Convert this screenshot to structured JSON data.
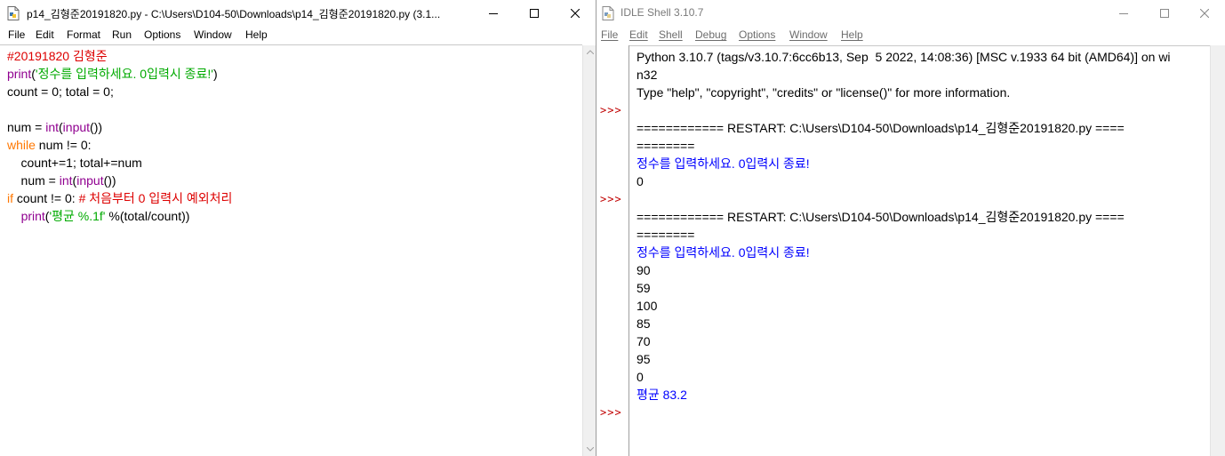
{
  "editor": {
    "title": "p14_김형준20191820.py - C:\\Users\\D104-50\\Downloads\\p14_김형준20191820.py (3.1...",
    "menu": [
      "File",
      "Edit",
      "Format",
      "Run",
      "Options",
      "Window",
      "Help"
    ],
    "code_lines": [
      [
        {
          "t": "#20191820 김형준",
          "c": "comment"
        }
      ],
      [
        {
          "t": "print",
          "c": "builtin"
        },
        {
          "t": "(",
          "c": ""
        },
        {
          "t": "'정수를 입력하세요. 0입력시 종료!'",
          "c": "string"
        },
        {
          "t": ")",
          "c": ""
        }
      ],
      [
        {
          "t": "count = 0; total = 0;",
          "c": ""
        }
      ],
      [
        {
          "t": "",
          "c": ""
        }
      ],
      [
        {
          "t": "num = ",
          "c": ""
        },
        {
          "t": "int",
          "c": "builtin"
        },
        {
          "t": "(",
          "c": ""
        },
        {
          "t": "input",
          "c": "builtin"
        },
        {
          "t": "())",
          "c": ""
        }
      ],
      [
        {
          "t": "while",
          "c": "keyword"
        },
        {
          "t": " num != 0:",
          "c": ""
        }
      ],
      [
        {
          "t": "    count+=1; total+=num",
          "c": ""
        }
      ],
      [
        {
          "t": "    num = ",
          "c": ""
        },
        {
          "t": "int",
          "c": "builtin"
        },
        {
          "t": "(",
          "c": ""
        },
        {
          "t": "input",
          "c": "builtin"
        },
        {
          "t": "())",
          "c": ""
        }
      ],
      [
        {
          "t": "if",
          "c": "keyword"
        },
        {
          "t": " count != 0: ",
          "c": ""
        },
        {
          "t": "# 처음부터 0 입력시 예외처리",
          "c": "comment"
        }
      ],
      [
        {
          "t": "    ",
          "c": ""
        },
        {
          "t": "print",
          "c": "builtin"
        },
        {
          "t": "(",
          "c": ""
        },
        {
          "t": "'평균 %.1f'",
          "c": "string"
        },
        {
          "t": " %(total/count))",
          "c": ""
        }
      ]
    ]
  },
  "shell": {
    "title": "IDLE Shell 3.10.7",
    "menu": [
      "File",
      "Edit",
      "Shell",
      "Debug",
      "Options",
      "Window",
      "Help"
    ],
    "prompt_symbol": ">>>",
    "prompt_rows": [
      3,
      8,
      20
    ],
    "lines": [
      {
        "t": "Python 3.10.7 (tags/v3.10.7:6cc6b13, Sep  5 2022, 14:08:36) [MSC v.1933 64 bit (AMD64)] on wi",
        "c": ""
      },
      {
        "t": "n32",
        "c": ""
      },
      {
        "t": "Type \"help\", \"copyright\", \"credits\" or \"license()\" for more information.",
        "c": ""
      },
      {
        "t": "",
        "c": ""
      },
      {
        "t": "============ RESTART: C:\\Users\\D104-50\\Downloads\\p14_김형준20191820.py ====",
        "c": ""
      },
      {
        "t": "========",
        "c": ""
      },
      {
        "t": "정수를 입력하세요. 0입력시 종료!",
        "c": "stdout"
      },
      {
        "t": "0",
        "c": ""
      },
      {
        "t": "",
        "c": ""
      },
      {
        "t": "============ RESTART: C:\\Users\\D104-50\\Downloads\\p14_김형준20191820.py ====",
        "c": ""
      },
      {
        "t": "========",
        "c": ""
      },
      {
        "t": "정수를 입력하세요. 0입력시 종료!",
        "c": "stdout"
      },
      {
        "t": "90",
        "c": ""
      },
      {
        "t": "59",
        "c": ""
      },
      {
        "t": "100",
        "c": ""
      },
      {
        "t": "85",
        "c": ""
      },
      {
        "t": "70",
        "c": ""
      },
      {
        "t": "95",
        "c": ""
      },
      {
        "t": "0",
        "c": ""
      },
      {
        "t": "평균 83.2",
        "c": "stdout"
      }
    ]
  }
}
